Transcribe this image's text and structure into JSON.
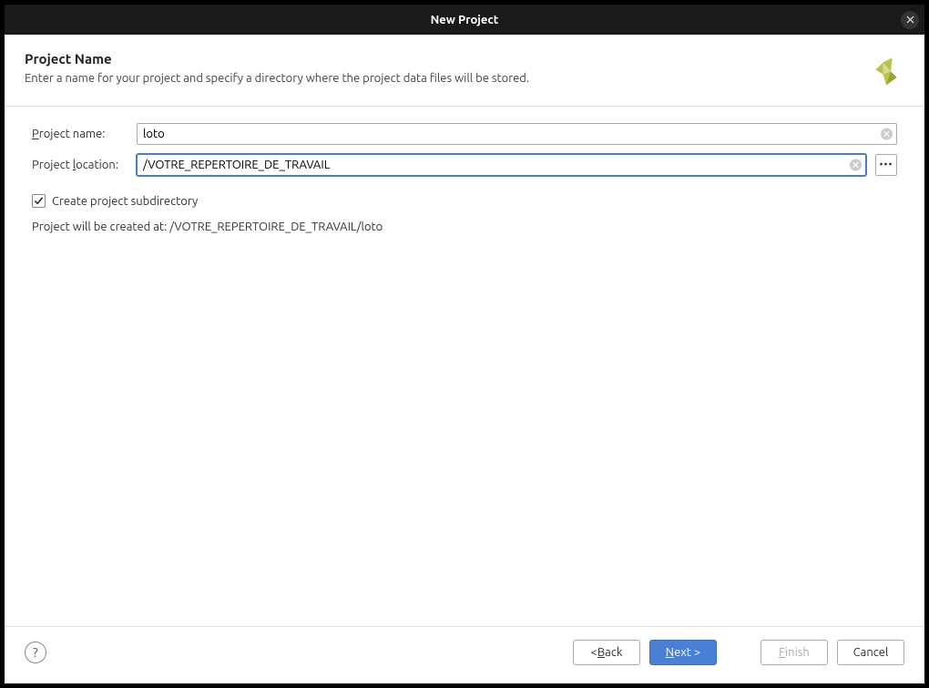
{
  "window": {
    "title": "New Project"
  },
  "header": {
    "title": "Project Name",
    "subtitle": "Enter a name for your project and specify a directory where the project data files will be stored."
  },
  "form": {
    "project_name_label_pre": "P",
    "project_name_label_post": "roject name:",
    "project_name_value": "loto",
    "project_location_label_pre": "Project ",
    "project_location_label_u": "l",
    "project_location_label_post": "ocation:",
    "project_location_value": "/VOTRE_REPERTOIRE_DE_TRAVAIL",
    "subdir_checkbox_checked": true,
    "subdir_label": "Create project subdirectory",
    "created_at_prefix": "Project will be created at: ",
    "created_at_path": "/VOTRE_REPERTOIRE_DE_TRAVAIL/loto"
  },
  "footer": {
    "back_pre": "< ",
    "back_u": "B",
    "back_post": "ack",
    "next_u": "N",
    "next_post": "ext >",
    "finish_u": "F",
    "finish_post": "inish",
    "cancel": "Cancel"
  }
}
